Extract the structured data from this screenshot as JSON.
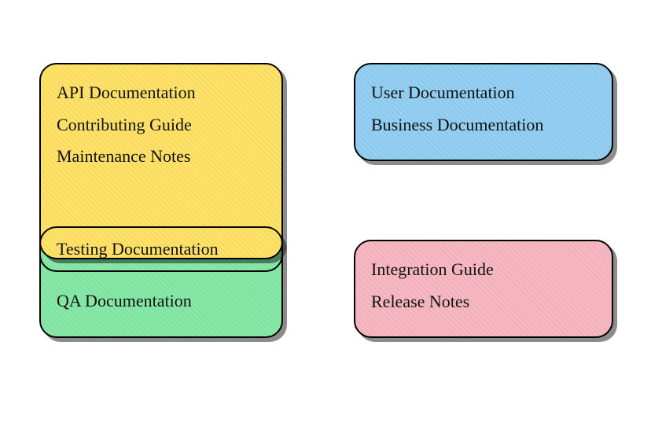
{
  "boxes": {
    "yellow": {
      "color": "#ffe168",
      "items": [
        "API Documentation",
        "Contributing Guide",
        "Maintenance Notes"
      ]
    },
    "green": {
      "color": "#86e8a6",
      "overlap_item": "Testing Documentation",
      "items": [
        "QA Documentation"
      ]
    },
    "blue": {
      "color": "#93cff2",
      "items": [
        "User Documentation",
        "Business Documentation"
      ]
    },
    "pink": {
      "color": "#f6b7c2",
      "items": [
        "Integration Guide",
        "Release Notes"
      ]
    }
  }
}
